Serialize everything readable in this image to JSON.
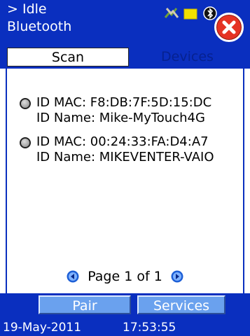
{
  "header": {
    "status_text": "> Idle",
    "title": "Bluetooth",
    "tray_icons": [
      "network-status-icon",
      "battery-icon",
      "bluetooth-icon"
    ],
    "close_icon": "close-icon"
  },
  "tabs": [
    {
      "label": "Scan",
      "active": true
    },
    {
      "label": "Devices",
      "active": false
    }
  ],
  "devices": [
    {
      "mac": "ID MAC: F8:DB:7F:5D:15:DC",
      "name": "ID Name: Mike-MyTouch4G",
      "selected": false
    },
    {
      "mac": "ID MAC: 00:24:33:FA:D4:A7",
      "name": "ID Name: MIKEVENTER-VAIO",
      "selected": false
    }
  ],
  "pager": {
    "label": "Page 1 of 1"
  },
  "actions": {
    "pair_label": "Pair",
    "services_label": "Services"
  },
  "statusbar": {
    "date": "19-May-2011",
    "time": "17:53:55"
  },
  "colors": {
    "header_blue": "#0a2fbf",
    "button_blue": "#6aa1ee",
    "close_red": "#e53324",
    "battery_yellow": "#f2e100"
  }
}
